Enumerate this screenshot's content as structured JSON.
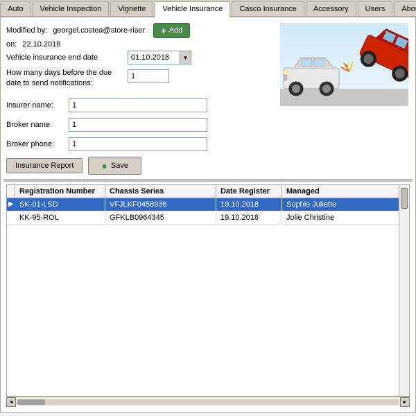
{
  "tabs": [
    {
      "id": "auto",
      "label": "Auto",
      "active": false
    },
    {
      "id": "vehicle-inspection",
      "label": "Vehicle Inspection",
      "active": false
    },
    {
      "id": "vignette",
      "label": "Vignette",
      "active": false
    },
    {
      "id": "vehicle-insurance",
      "label": "Vehicle Insurance",
      "active": true
    },
    {
      "id": "casco-insurance",
      "label": "Casco Insurance",
      "active": false
    },
    {
      "id": "accessory",
      "label": "Accessory",
      "active": false
    },
    {
      "id": "users",
      "label": "Users",
      "active": false
    },
    {
      "id": "about",
      "label": "About",
      "active": false
    }
  ],
  "form": {
    "modified_by_label": "Modified by:",
    "modified_by_value": "georgel.costea@store-riser",
    "on_label": "on:",
    "on_date": "22.10.2018",
    "add_button": "Add",
    "insurance_end_date_label": "Vehicle insurance end date",
    "insurance_end_date_value": "01.10.2018",
    "days_notification_label": "How many days before the due\ndate to send notifications:",
    "days_notification_value": "1",
    "insurer_name_label": "Insurer name:",
    "insurer_name_value": "1",
    "broker_name_label": "Broker name:",
    "broker_name_value": "1",
    "broker_phone_label": "Broker phone:",
    "broker_phone_value": "1",
    "insurance_report_button": "Insurance Report",
    "save_button": "Save"
  },
  "table": {
    "columns": [
      {
        "id": "reg",
        "label": "Registration Number"
      },
      {
        "id": "chassis",
        "label": "Chassis Series"
      },
      {
        "id": "date",
        "label": "Date Register"
      },
      {
        "id": "managed",
        "label": "Managed"
      }
    ],
    "rows": [
      {
        "selected": true,
        "indicator": "▶",
        "reg": "SK-01-LSD",
        "chassis": "VFJLKF0458936",
        "date": "19.10.2018",
        "managed": "Sophie Juliette"
      },
      {
        "selected": false,
        "indicator": "",
        "reg": "KK-95-ROL",
        "chassis": "GFKLB0964345",
        "date": "19.10.2018",
        "managed": "Jolie Christine"
      }
    ]
  },
  "icons": {
    "add": "+",
    "save": "●",
    "arrow_up": "▲",
    "arrow_down": "▼",
    "scroll_left": "◄",
    "scroll_right": "►"
  }
}
